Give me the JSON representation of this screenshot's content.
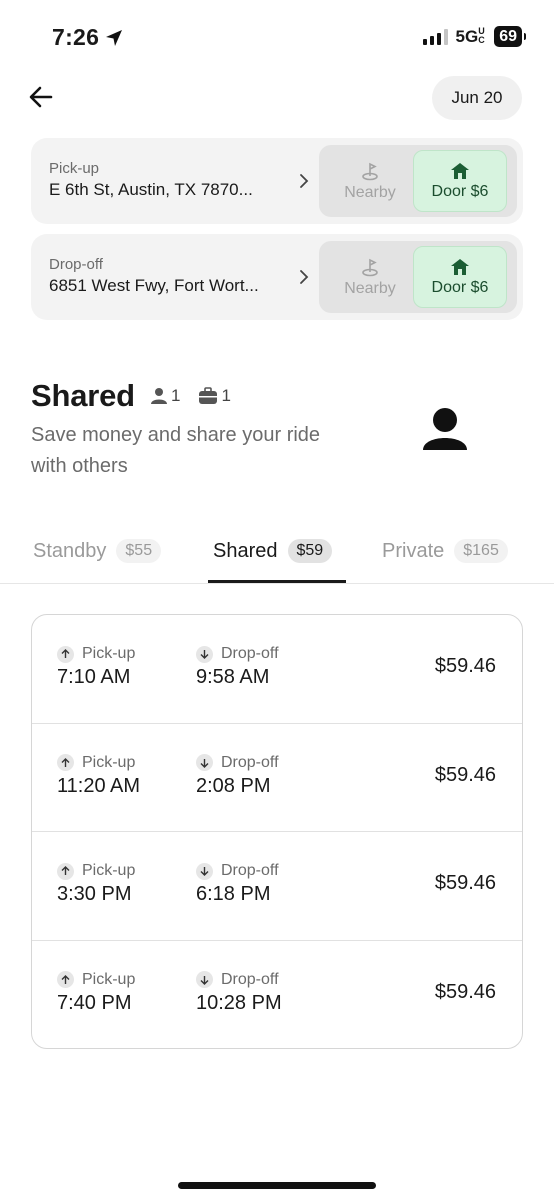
{
  "status_bar": {
    "time": "7:26",
    "network": "5G",
    "network_suffix": "UC",
    "battery": "69"
  },
  "header": {
    "date": "Jun 20"
  },
  "pickup": {
    "label": "Pick-up",
    "address": "E 6th St, Austin, TX  7870...",
    "nearby_label": "Nearby",
    "door_label": "Door $6"
  },
  "dropoff": {
    "label": "Drop-off",
    "address": "6851 West Fwy, Fort Wort...",
    "nearby_label": "Nearby",
    "door_label": "Door $6"
  },
  "ride": {
    "title": "Shared",
    "passengers": "1",
    "bags": "1",
    "description": "Save money and share your ride with others"
  },
  "tabs": [
    {
      "label": "Standby",
      "price": "$55"
    },
    {
      "label": "Shared",
      "price": "$59"
    },
    {
      "label": "Private",
      "price": "$165"
    }
  ],
  "schedule": {
    "pickup_label": "Pick-up",
    "dropoff_label": "Drop-off",
    "trips": [
      {
        "pickup_time": "7:10 AM",
        "dropoff_time": "9:58 AM",
        "price": "$59.46"
      },
      {
        "pickup_time": "11:20 AM",
        "dropoff_time": "2:08 PM",
        "price": "$59.46"
      },
      {
        "pickup_time": "3:30 PM",
        "dropoff_time": "6:18 PM",
        "price": "$59.46"
      },
      {
        "pickup_time": "7:40 PM",
        "dropoff_time": "10:28 PM",
        "price": "$59.46"
      }
    ]
  },
  "colors": {
    "door_bg": "#d7f3df",
    "door_text": "#1b4d2e"
  }
}
